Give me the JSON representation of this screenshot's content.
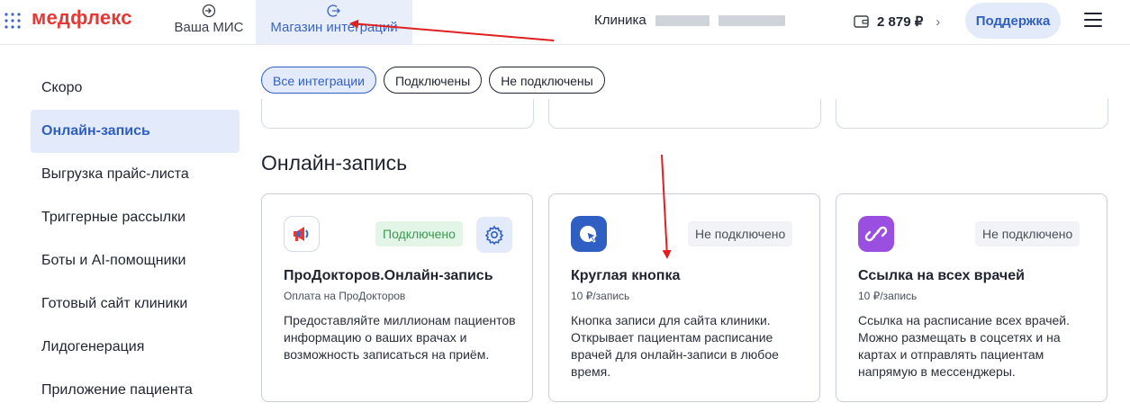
{
  "brand": {
    "logo_text": "медфлекс",
    "accent": "#e53935"
  },
  "header": {
    "nav": [
      {
        "label": "Ваша МИС",
        "icon": "login-icon"
      },
      {
        "label": "Магазин интеграций",
        "icon": "exit-arrow-icon",
        "active": true
      }
    ],
    "clinic_label": "Клиника",
    "balance": "2 879 ₽",
    "support_label": "Поддержка"
  },
  "sidebar": {
    "items": [
      {
        "label": "Скоро"
      },
      {
        "label": "Онлайн-запись",
        "active": true
      },
      {
        "label": "Выгрузка прайс-листа"
      },
      {
        "label": "Триггерные рассылки"
      },
      {
        "label": "Боты и AI-помощники"
      },
      {
        "label": "Готовый сайт клиники"
      },
      {
        "label": "Лидогенерация"
      },
      {
        "label": "Приложение пациента"
      }
    ]
  },
  "filters": [
    {
      "label": "Все интеграции",
      "active": true
    },
    {
      "label": "Подключены"
    },
    {
      "label": "Не подключены"
    }
  ],
  "section_title": "Онлайн-запись",
  "cards": [
    {
      "title": "ПроДокторов.Онлайн-запись",
      "subtitle": "Оплата на ПроДокторов",
      "status": "Подключено",
      "description": "Предоставляйте миллионам пациентов информацию о ваших врачах и возможность записаться на приём."
    },
    {
      "title": "Круглая кнопка",
      "subtitle": "10 ₽/запись",
      "status": "Не подключено",
      "description": "Кнопка записи для сайта клиники. Открывает пациентам расписание врачей для онлайн-записи в любое время."
    },
    {
      "title": "Ссылка на всех врачей",
      "subtitle": "10 ₽/запись",
      "status": "Не подключено",
      "description": "Ссылка на расписание всех врачей. Можно размещать в соцсетях и на картах и отправлять пациентам напрямую в мессенджеры."
    }
  ],
  "colors": {
    "primary": "#2f5fc2",
    "active_bg": "#e3ebfa",
    "connected": "#3a9a53",
    "annotation": "#e02020"
  }
}
